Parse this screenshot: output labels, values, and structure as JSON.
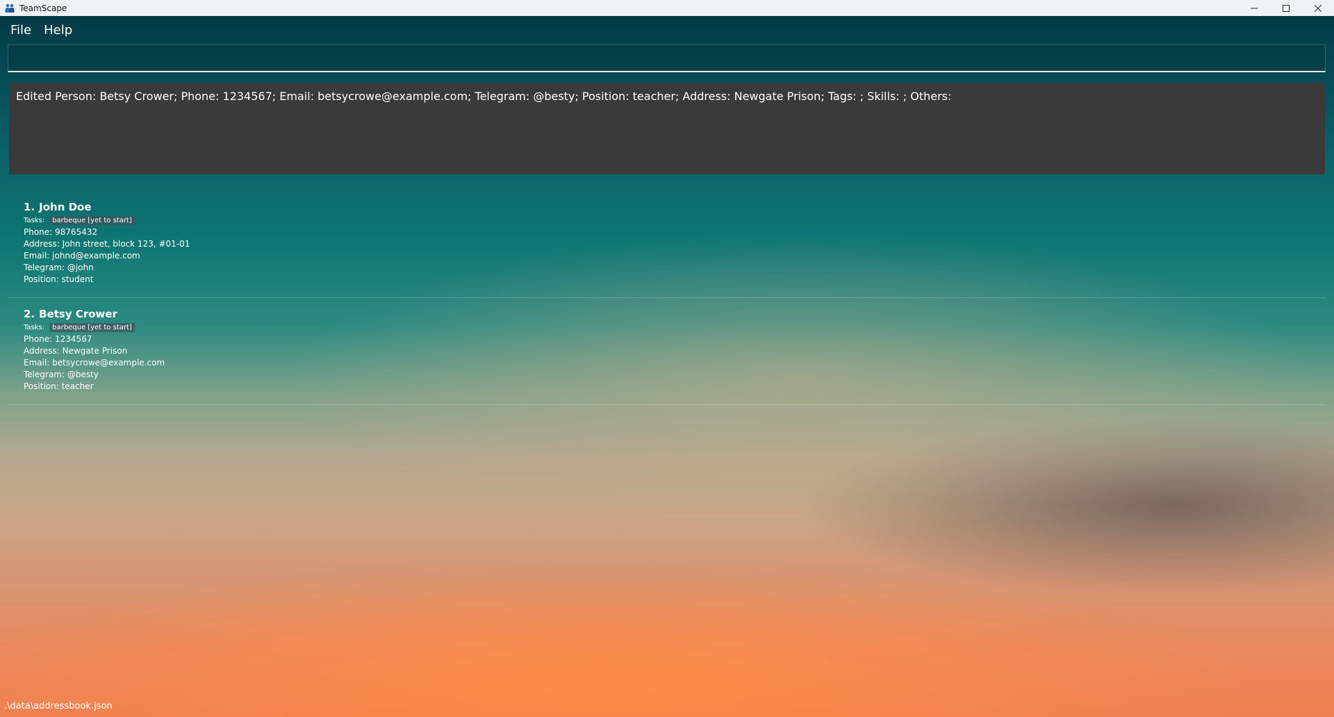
{
  "window": {
    "title": "TeamScape",
    "icon": "people-icon",
    "controls": [
      "minimize-icon",
      "maximize-icon",
      "close-icon"
    ]
  },
  "menu": {
    "items": [
      "File",
      "Help"
    ]
  },
  "command": {
    "value": "",
    "placeholder": ""
  },
  "result": {
    "text": "Edited Person: Betsy Crower; Phone: 1234567; Email: betsycrowe@example.com; Telegram: @besty; Position: teacher; Address: Newgate Prison; Tags: ; Skills: ; Others:"
  },
  "persons": [
    {
      "index": "1.",
      "name": "John Doe",
      "tasks_label": "Tasks:",
      "tasks": [
        "barbeque [yet to start]"
      ],
      "phone": "Phone: 98765432",
      "address": "Address: John street, block 123, #01-01",
      "email": "Email: johnd@example.com",
      "telegram": "Telegram: @john",
      "position": "Position: student"
    },
    {
      "index": "2.",
      "name": "Betsy Crower",
      "tasks_label": "Tasks:",
      "tasks": [
        "barbeque [yet to start]"
      ],
      "phone": "Phone: 1234567",
      "address": "Address: Newgate Prison",
      "email": "Email: betsycrowe@example.com",
      "telegram": "Telegram: @besty",
      "position": "Position: teacher"
    }
  ],
  "status": {
    "path": ".\\data\\addressbook.json"
  }
}
